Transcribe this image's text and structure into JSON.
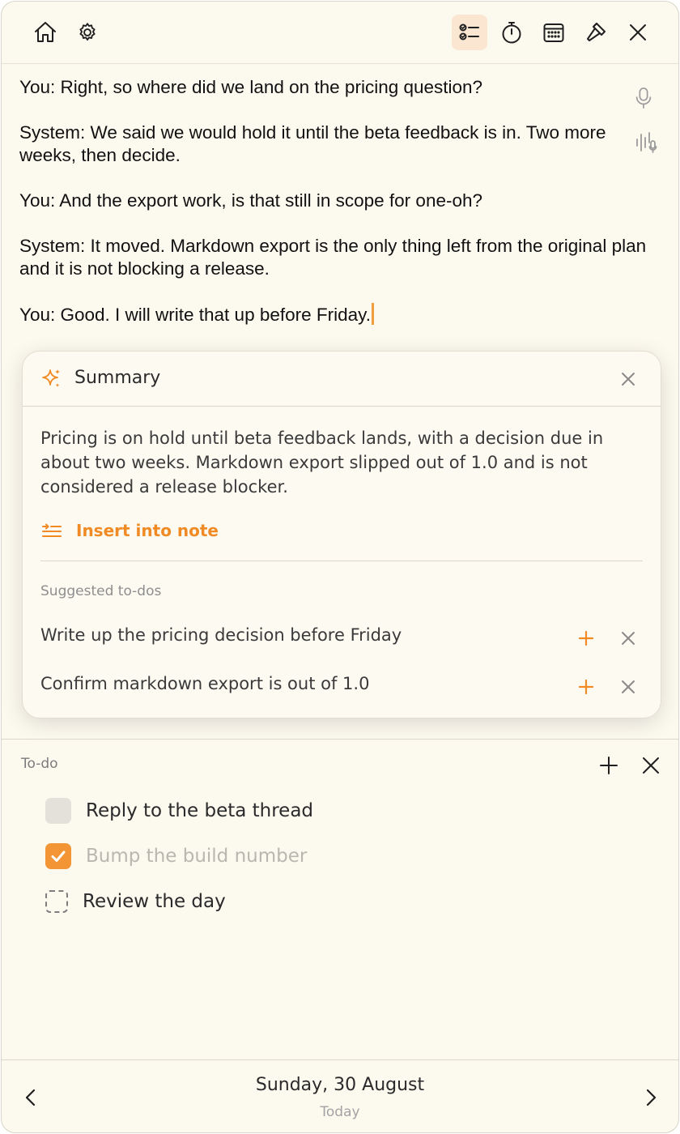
{
  "colors": {
    "background": "#fcf9ef",
    "accent": "#f08a25",
    "active_tool_bg": "#fbe6d2",
    "checkbox_checked": "#f39535"
  },
  "toolbar": {
    "left": [
      {
        "name": "home-icon"
      },
      {
        "name": "gear-icon"
      }
    ],
    "right": [
      {
        "name": "checklist-icon",
        "active": true
      },
      {
        "name": "stopwatch-icon"
      },
      {
        "name": "calendar-icon"
      },
      {
        "name": "hammer-icon"
      },
      {
        "name": "close-icon"
      }
    ]
  },
  "transcript": {
    "lines": [
      "You: Right, so where did we land on the pricing question?",
      "System: We said we would hold it until the beta feedback is in. Two more weeks, then decide.",
      "You: And the export work, is that still in scope for one-oh?",
      "System: It moved. Markdown export is the only thing left from the original plan and it is not blocking a release.",
      "You: Good. I will write that up before Friday."
    ],
    "side_icons": [
      "microphone-icon",
      "voice-waveform-icon"
    ]
  },
  "summary": {
    "title": "Summary",
    "body": "Pricing is on hold until beta feedback lands, with a decision due in about two weeks. Markdown export slipped out of 1.0 and is not considered a release blocker.",
    "insert_label": "Insert into note",
    "suggested_heading": "Suggested to-dos",
    "suggestions": [
      "Write up the pricing decision before Friday",
      "Confirm markdown export is out of 1.0"
    ]
  },
  "todo": {
    "heading": "To-do",
    "items": [
      {
        "label": "Reply to the beta thread",
        "state": "unchecked"
      },
      {
        "label": "Bump the build number",
        "state": "checked"
      },
      {
        "label": "Review the day",
        "state": "dashed"
      }
    ]
  },
  "footer": {
    "date": "Sunday, 30 August",
    "sub": "Today"
  }
}
